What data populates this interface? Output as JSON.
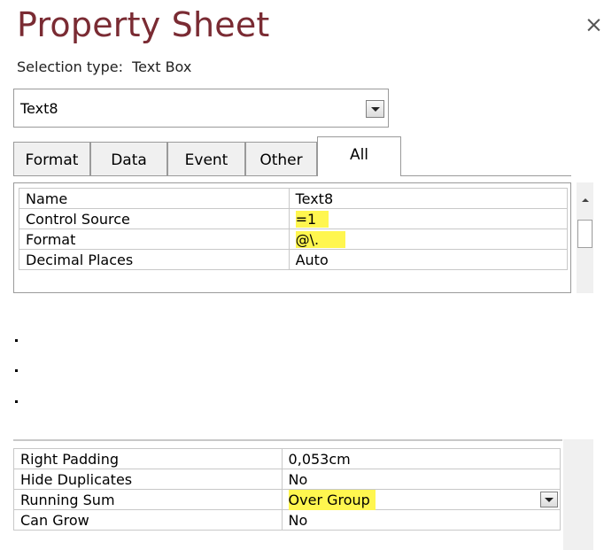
{
  "header": {
    "title": "Property Sheet",
    "close_glyph": "×"
  },
  "selection": {
    "label": "Selection type:",
    "type": "Text Box"
  },
  "object_select": {
    "value": "Text8"
  },
  "tabs": [
    {
      "label": "Format"
    },
    {
      "label": "Data"
    },
    {
      "label": "Event"
    },
    {
      "label": "Other"
    },
    {
      "label": "All",
      "active": true
    }
  ],
  "properties_top": [
    {
      "name": "Name",
      "value": "Text8"
    },
    {
      "name": "Control Source",
      "value": "=1",
      "highlighted": true
    },
    {
      "name": "Format",
      "value": "@\\.",
      "highlighted": true
    },
    {
      "name": "Decimal Places",
      "value": "Auto"
    }
  ],
  "ellipsis_dots": [
    ".",
    ".",
    "."
  ],
  "properties_bottom": [
    {
      "name": "Right Padding",
      "value": "0,053cm"
    },
    {
      "name": "Hide Duplicates",
      "value": "No"
    },
    {
      "name": "Running Sum",
      "value": "Over Group",
      "highlighted": true,
      "has_dropdown": true
    },
    {
      "name": "Can Grow",
      "value": "No"
    }
  ],
  "colors": {
    "title": "#7a2b33",
    "highlight": "#fff64f",
    "border": "#9a9a9a"
  }
}
